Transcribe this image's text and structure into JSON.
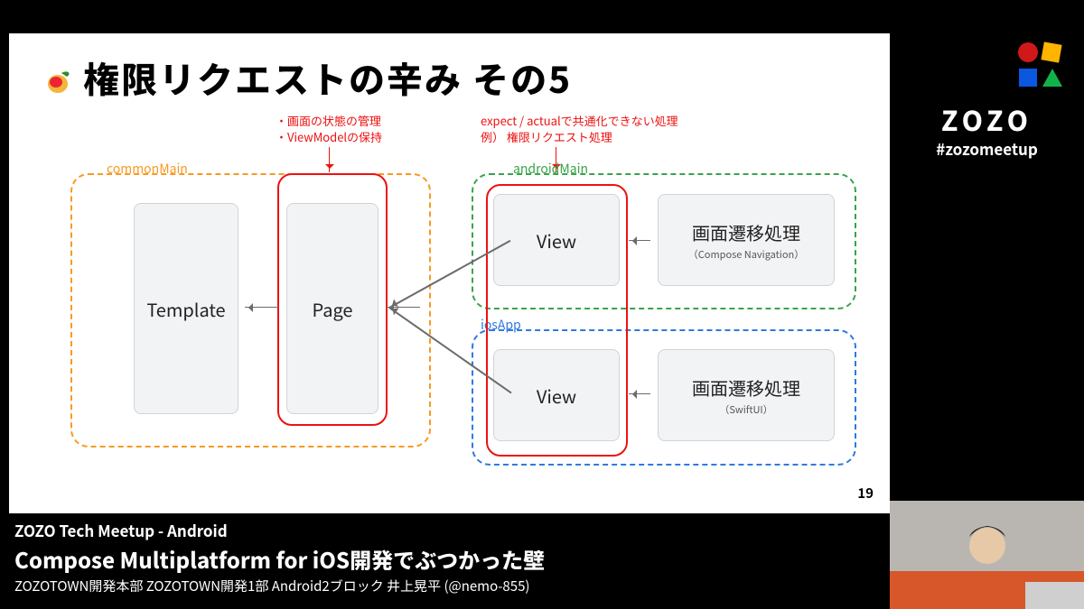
{
  "slide": {
    "title": "権限リクエストの辛み その5",
    "notes": {
      "page_annotation": "・画面の状態の管理\n・ViewModelの保持",
      "view_annotation": "expect / actualで共通化できない処理\n例） 権限リクエスト処理"
    },
    "labels": {
      "commonMain": "commonMain",
      "androidMain": "androidMain",
      "iosApp": "iosApp"
    },
    "cards": {
      "template": "Template",
      "page": "Page",
      "view_a": "View",
      "nav_a_main": "画面遷移処理",
      "nav_a_sub": "（Compose Navigation）",
      "view_i": "View",
      "nav_i_main": "画面遷移処理",
      "nav_i_sub": "（SwiftUI）"
    },
    "page_no": "19"
  },
  "branding": {
    "zozo": "ZOZO",
    "hashtag": "#zozomeetup"
  },
  "footer": {
    "event": "ZOZO Tech Meetup - Android",
    "talk_title": "Compose Multiplatform for iOS開発でぶつかった壁",
    "speaker": "ZOZOTOWN開発本部 ZOZOTOWN開発1部 Android2ブロック 井上晃平 (@nemo-855)"
  }
}
